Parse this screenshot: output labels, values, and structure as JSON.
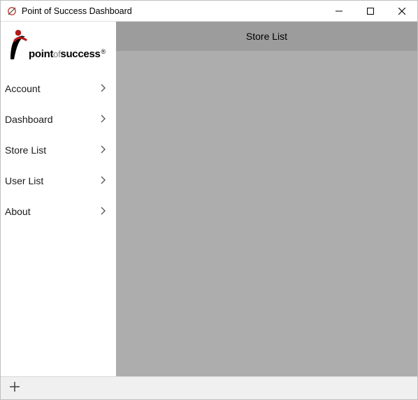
{
  "window": {
    "title": "Point of Success Dashboard"
  },
  "logo": {
    "point": "point",
    "of": "of",
    "success": "success",
    "reg": "®"
  },
  "sidebar": {
    "items": [
      {
        "label": "Account"
      },
      {
        "label": "Dashboard"
      },
      {
        "label": "Store List"
      },
      {
        "label": "User List"
      },
      {
        "label": "About"
      }
    ]
  },
  "content": {
    "header": "Store List"
  }
}
